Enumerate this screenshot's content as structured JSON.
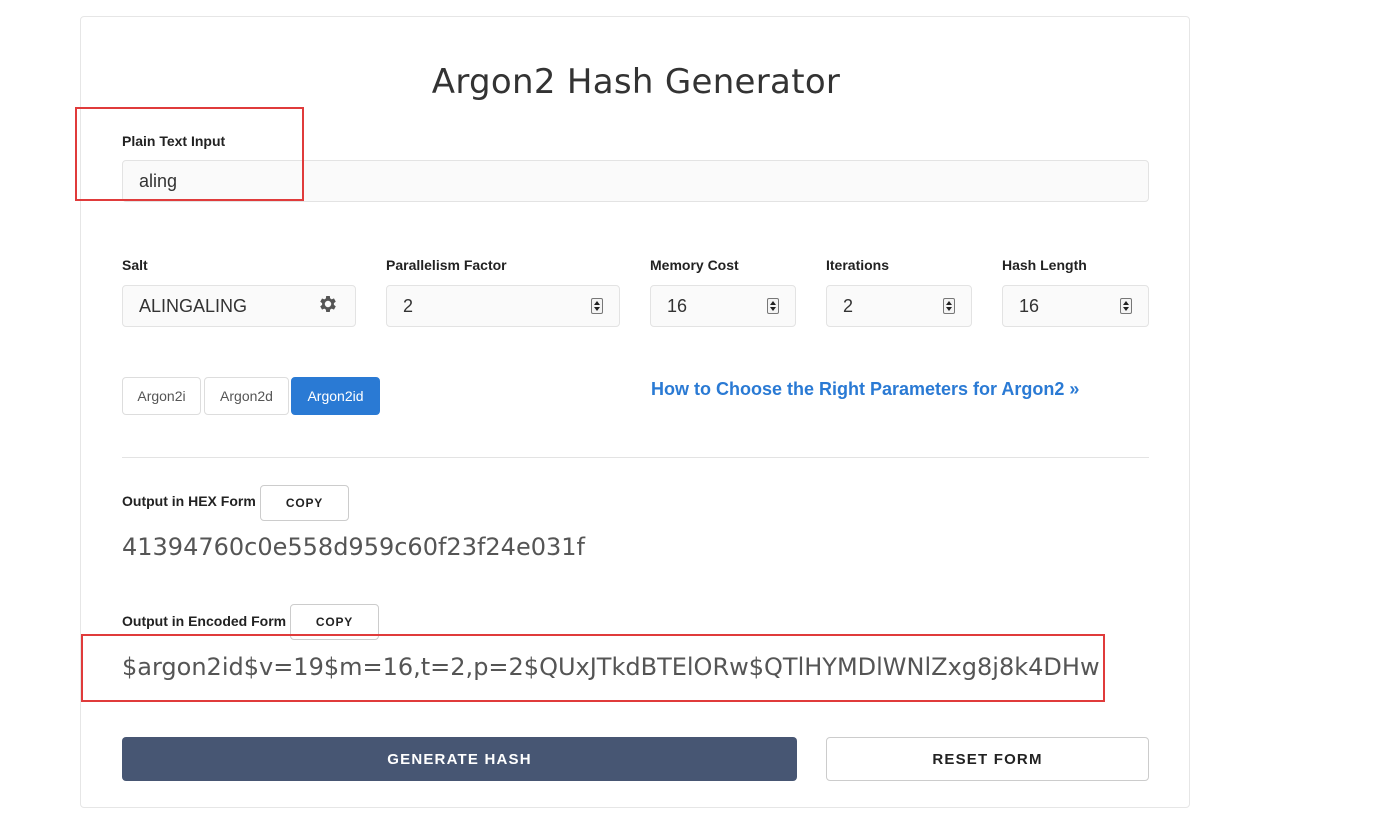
{
  "title": "Argon2 Hash Generator",
  "plain_text": {
    "label": "Plain Text Input",
    "value": "aling"
  },
  "salt": {
    "label": "Salt",
    "value": "ALINGALING",
    "icon": "gear-icon"
  },
  "parallelism": {
    "label": "Parallelism Factor",
    "value": "2"
  },
  "memory": {
    "label": "Memory Cost",
    "value": "16"
  },
  "iterations": {
    "label": "Iterations",
    "value": "2"
  },
  "hash_length": {
    "label": "Hash Length",
    "value": "16"
  },
  "algorithms": [
    {
      "label": "Argon2i",
      "active": false
    },
    {
      "label": "Argon2d",
      "active": false
    },
    {
      "label": "Argon2id",
      "active": true
    }
  ],
  "help_link": "How to Choose the Right Parameters for Argon2 »",
  "hex_output": {
    "label": "Output in HEX Form",
    "copy_label": "COPY",
    "value": "41394760c0e558d959c60f23f24e031f"
  },
  "encoded_output": {
    "label": "Output in Encoded Form",
    "copy_label": "COPY",
    "value": "$argon2id$v=19$m=16,t=2,p=2$QUxJTkdBTElORw$QTlHYMDlWNlZxg8j8k4DHw"
  },
  "buttons": {
    "generate": "GENERATE HASH",
    "reset": "RESET FORM"
  },
  "colors": {
    "accent": "#2a7ad4",
    "generate_bg": "#475673",
    "highlight": "#e03b3b"
  }
}
